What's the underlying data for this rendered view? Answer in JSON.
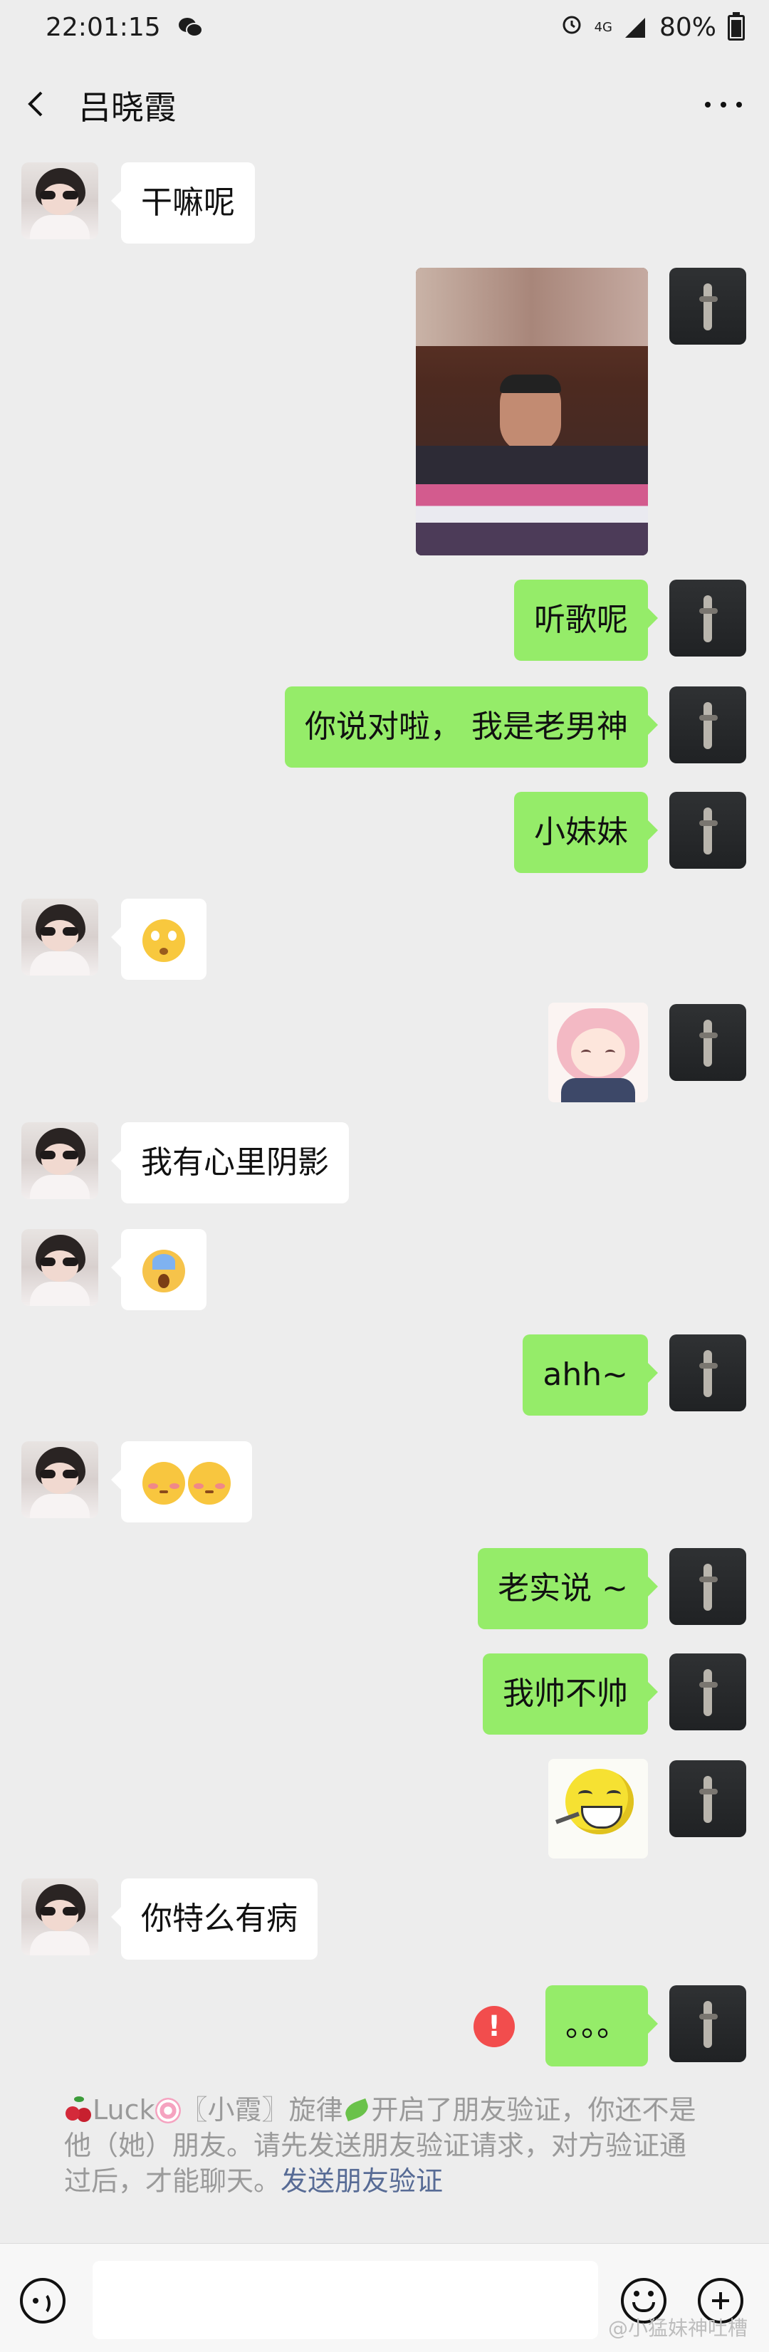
{
  "status_bar": {
    "time": "22:01:15",
    "network": "4G",
    "battery": "80%"
  },
  "header": {
    "contact_name": "吕晓霞"
  },
  "messages": [
    {
      "side": "left",
      "type": "text",
      "text": "干嘛呢"
    },
    {
      "side": "right",
      "type": "image",
      "text": ""
    },
    {
      "side": "right",
      "type": "text",
      "text": "听歌呢"
    },
    {
      "side": "right",
      "type": "text",
      "text": "你说对啦， 我是老男神"
    },
    {
      "side": "right",
      "type": "text",
      "text": "小妹妹"
    },
    {
      "side": "left",
      "type": "emoji",
      "emoji": [
        "flushed-face-emoji"
      ]
    },
    {
      "side": "right",
      "type": "sticker",
      "text": ""
    },
    {
      "side": "left",
      "type": "text",
      "text": "我有心里阴影"
    },
    {
      "side": "left",
      "type": "emoji",
      "emoji": [
        "scream-face-emoji"
      ]
    },
    {
      "side": "right",
      "type": "text",
      "text": "ahh~"
    },
    {
      "side": "left",
      "type": "emoji",
      "emoji": [
        "shy-face-emoji",
        "shy-face-emoji"
      ]
    },
    {
      "side": "right",
      "type": "text",
      "text": "老实说 ~"
    },
    {
      "side": "right",
      "type": "text",
      "text": "我帅不帅"
    },
    {
      "side": "right",
      "type": "sticker",
      "text": ""
    },
    {
      "side": "left",
      "type": "text",
      "text": "你特么有病"
    },
    {
      "side": "right",
      "type": "text",
      "text": "。。。",
      "failed": true
    }
  ],
  "system_notice": {
    "name_part1": "Luck",
    "name_part2": "〖小霞〗旋律",
    "text": "开启了朋友验证，你还不是他（她）朋友。请先发送朋友验证请求，对方验证通过后，才能聊天。",
    "link": "发送朋友验证"
  },
  "watermark": "@小猛妹神吐槽",
  "icons": {
    "back": "chevron-left-icon",
    "more": "more-dots-icon",
    "voice": "voice-icon",
    "emoji": "emoji-icon",
    "plus": "plus-icon",
    "error": "error-icon"
  },
  "colors": {
    "background": "#ededed",
    "bubble_out": "#95ec69",
    "bubble_in": "#ffffff",
    "link": "#576b95",
    "error": "#f24d4d"
  }
}
